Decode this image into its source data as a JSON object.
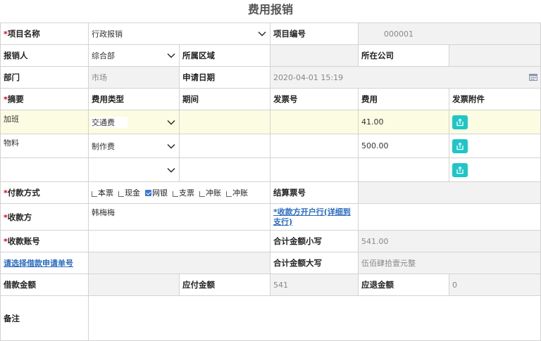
{
  "title": "费用报销",
  "fields": {
    "project_name_label": "项目名称",
    "project_name_value": "行政报销",
    "project_no_label": "项目编号",
    "project_no_value": "000001",
    "reporter_label": "报销人",
    "reporter_value": "综合部",
    "region_label": "所属区域",
    "company_label": "所在公司",
    "dept_label": "部门",
    "dept_value": "市场",
    "apply_date_label": "申请日期",
    "apply_date_value": "2020-04-01 15:19"
  },
  "table": {
    "headers": {
      "summary": "摘要",
      "type": "费用类型",
      "period": "期间",
      "invoice_no": "发票号",
      "amount": "费用",
      "attachment": "发票附件"
    },
    "rows": [
      {
        "summary": "加班",
        "type": "交通费",
        "amount": "41.00"
      },
      {
        "summary": "物料",
        "type": "制作费",
        "amount": "500.00"
      },
      {
        "summary": "",
        "type": "",
        "amount": ""
      }
    ]
  },
  "payment": {
    "method_label": "付款方式",
    "options": [
      "本票",
      "现金",
      "网银",
      "支票",
      "冲账",
      "冲账"
    ],
    "checked_index": 2,
    "settle_no_label": "结算票号",
    "payee_label": "收款方",
    "payee_value": "韩梅梅",
    "payee_bank_link": "*收款方开户行(详细到支行)",
    "account_label": "收款账号",
    "total_small_label": "合计金额小写",
    "total_small_value": "541.00",
    "loan_link": "请选择借款申请单号",
    "total_big_label": "合计金额大写",
    "total_big_value": "伍佰肆拾壹元整",
    "loan_amount_label": "借款金额",
    "payable_label": "应付金额",
    "payable_value": "541",
    "refund_label": "应退金额",
    "refund_value": "0",
    "remark_label": "备注"
  },
  "colors": {
    "required": "#d8000c",
    "link": "#2a6bbf",
    "upload": "#1ec6c6",
    "highlight_row": "#fcfce2",
    "readonly_bg": "#f2f2f2"
  },
  "icons": [
    "chevron-down-icon",
    "upload-icon",
    "calendar-icon",
    "checkbox-icon"
  ]
}
